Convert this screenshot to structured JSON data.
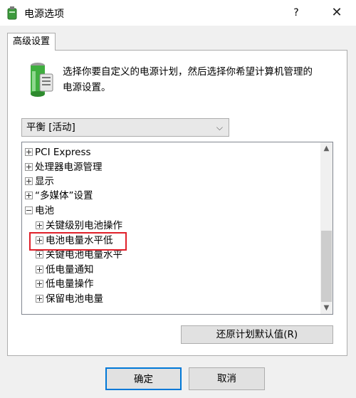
{
  "window": {
    "title": "电源选项",
    "help": "?",
    "close": "✕"
  },
  "tab": {
    "label": "高级设置"
  },
  "description": {
    "line1": "选择你要自定义的电源计划，然后选择你希望计算机管理的",
    "line2": "电源设置。"
  },
  "plan_select": {
    "value": "平衡 [活动]",
    "chevron": "⌵"
  },
  "tree": {
    "items": [
      {
        "label": "PCI Express",
        "expander": "plus"
      },
      {
        "label": "处理器电源管理",
        "expander": "plus"
      },
      {
        "label": "显示",
        "expander": "plus"
      },
      {
        "label": "“多媒体”设置",
        "expander": "plus"
      },
      {
        "label": "电池",
        "expander": "minus"
      },
      {
        "label": "关键级别电池操作",
        "expander": "plus"
      },
      {
        "label": "电池电量水平低",
        "expander": "plus"
      },
      {
        "label": "关键电池电量水平",
        "expander": "plus"
      },
      {
        "label": "低电量通知",
        "expander": "plus"
      },
      {
        "label": "低电量操作",
        "expander": "plus"
      },
      {
        "label": "保留电池电量",
        "expander": "plus"
      }
    ],
    "scroll_up": "▲",
    "scroll_down": "▼"
  },
  "buttons": {
    "restore": "还原计划默认值(R)",
    "ok": "确定",
    "cancel": "取消"
  },
  "colors": {
    "highlight": "#e0202a",
    "accent": "#0078d7"
  }
}
